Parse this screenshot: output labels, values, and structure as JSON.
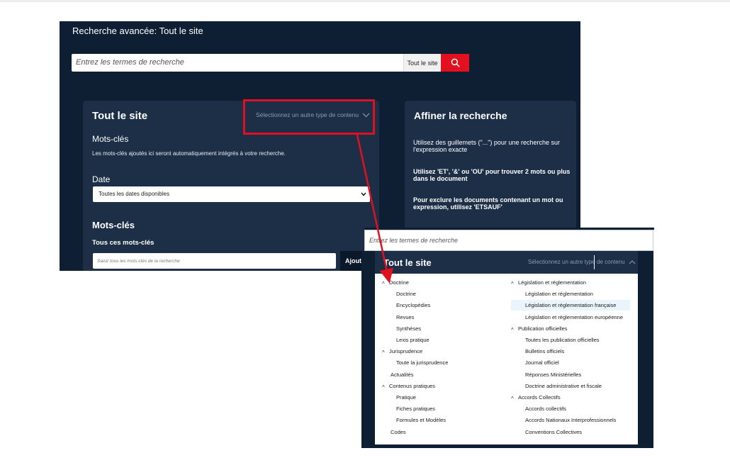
{
  "header": {
    "title": "Recherche avancée: Tout le site"
  },
  "search": {
    "placeholder": "Entrez les termes de recherche",
    "scope": "Tout le site"
  },
  "left_card": {
    "title": "Tout le site",
    "select_type": "Sélectionnez un autre type de contenu",
    "keywords_label": "Mots-clés",
    "keywords_note": "Les mots-clés ajoutés ici seront automatiquement intégrés à votre recherche.",
    "date_label": "Date",
    "date_value": "Toutes les dates disponibles",
    "keywords_section": "Mots-clés",
    "all_keywords_label": "Tous ces mots-clés",
    "all_keywords_placeholder": "Saisir tous les mots-clés de la recherche",
    "add_button": "Ajouter"
  },
  "right_card": {
    "title": "Affiner la recherche",
    "tips": [
      "Utilisez des guillemets (\"...\") pour une recherche sur l'expression exacte",
      "Utilisez 'ET', '&' ou 'OU' pour trouver 2 mots ou plus dans le document",
      "Pour exclure les documents contenant un mot ou expression, utilisez 'ETSAUF'"
    ]
  },
  "zoom": {
    "search_placeholder": "Entrez les termes de recherche",
    "title": "Tout le site",
    "select_type": "Sélectionnez un autre type de contenu",
    "menu_left": [
      {
        "label": "Doctrine",
        "group": true
      },
      {
        "label": "Doctrine",
        "group": false
      },
      {
        "label": "Encyclopédies",
        "group": false
      },
      {
        "label": "Revues",
        "group": false
      },
      {
        "label": "Synthèses",
        "group": false
      },
      {
        "label": "Lexis pratique",
        "group": false
      },
      {
        "label": "Jurisprudence",
        "group": true
      },
      {
        "label": "Toute la jurisprudence",
        "group": false
      },
      {
        "label": "Actualités",
        "group": false,
        "top": true
      },
      {
        "label": "Contenus pratiques",
        "group": true
      },
      {
        "label": "Pratique",
        "group": false
      },
      {
        "label": "Fiches pratiques",
        "group": false
      },
      {
        "label": "Formules et Modèles",
        "group": false
      },
      {
        "label": "Codes",
        "group": false,
        "top": true
      }
    ],
    "menu_right": [
      {
        "label": "Législation et réglementation",
        "group": true
      },
      {
        "label": "Législation et réglementation",
        "group": false
      },
      {
        "label": "Législation et réglementation française",
        "group": false,
        "highlight": true
      },
      {
        "label": "Législation et réglementation européenne",
        "group": false
      },
      {
        "label": "Publication officielles",
        "group": true
      },
      {
        "label": "Toutes les publication officielles",
        "group": false
      },
      {
        "label": "Bulletins officiels",
        "group": false
      },
      {
        "label": "Journal officiel",
        "group": false
      },
      {
        "label": "Réponses Ministérielles",
        "group": false
      },
      {
        "label": "Doctrine administrative et fiscale",
        "group": false
      },
      {
        "label": "Accords Collectifs",
        "group": true
      },
      {
        "label": "Accords collectifs",
        "group": false
      },
      {
        "label": "Accords Nationaux Interprofessionnels",
        "group": false
      },
      {
        "label": "Conventions Collectives",
        "group": false
      }
    ]
  },
  "colors": {
    "navy": "#0f1f33",
    "card": "#1c2f47",
    "accent_red": "#e3111f",
    "highlight": "#eaf4fb"
  }
}
